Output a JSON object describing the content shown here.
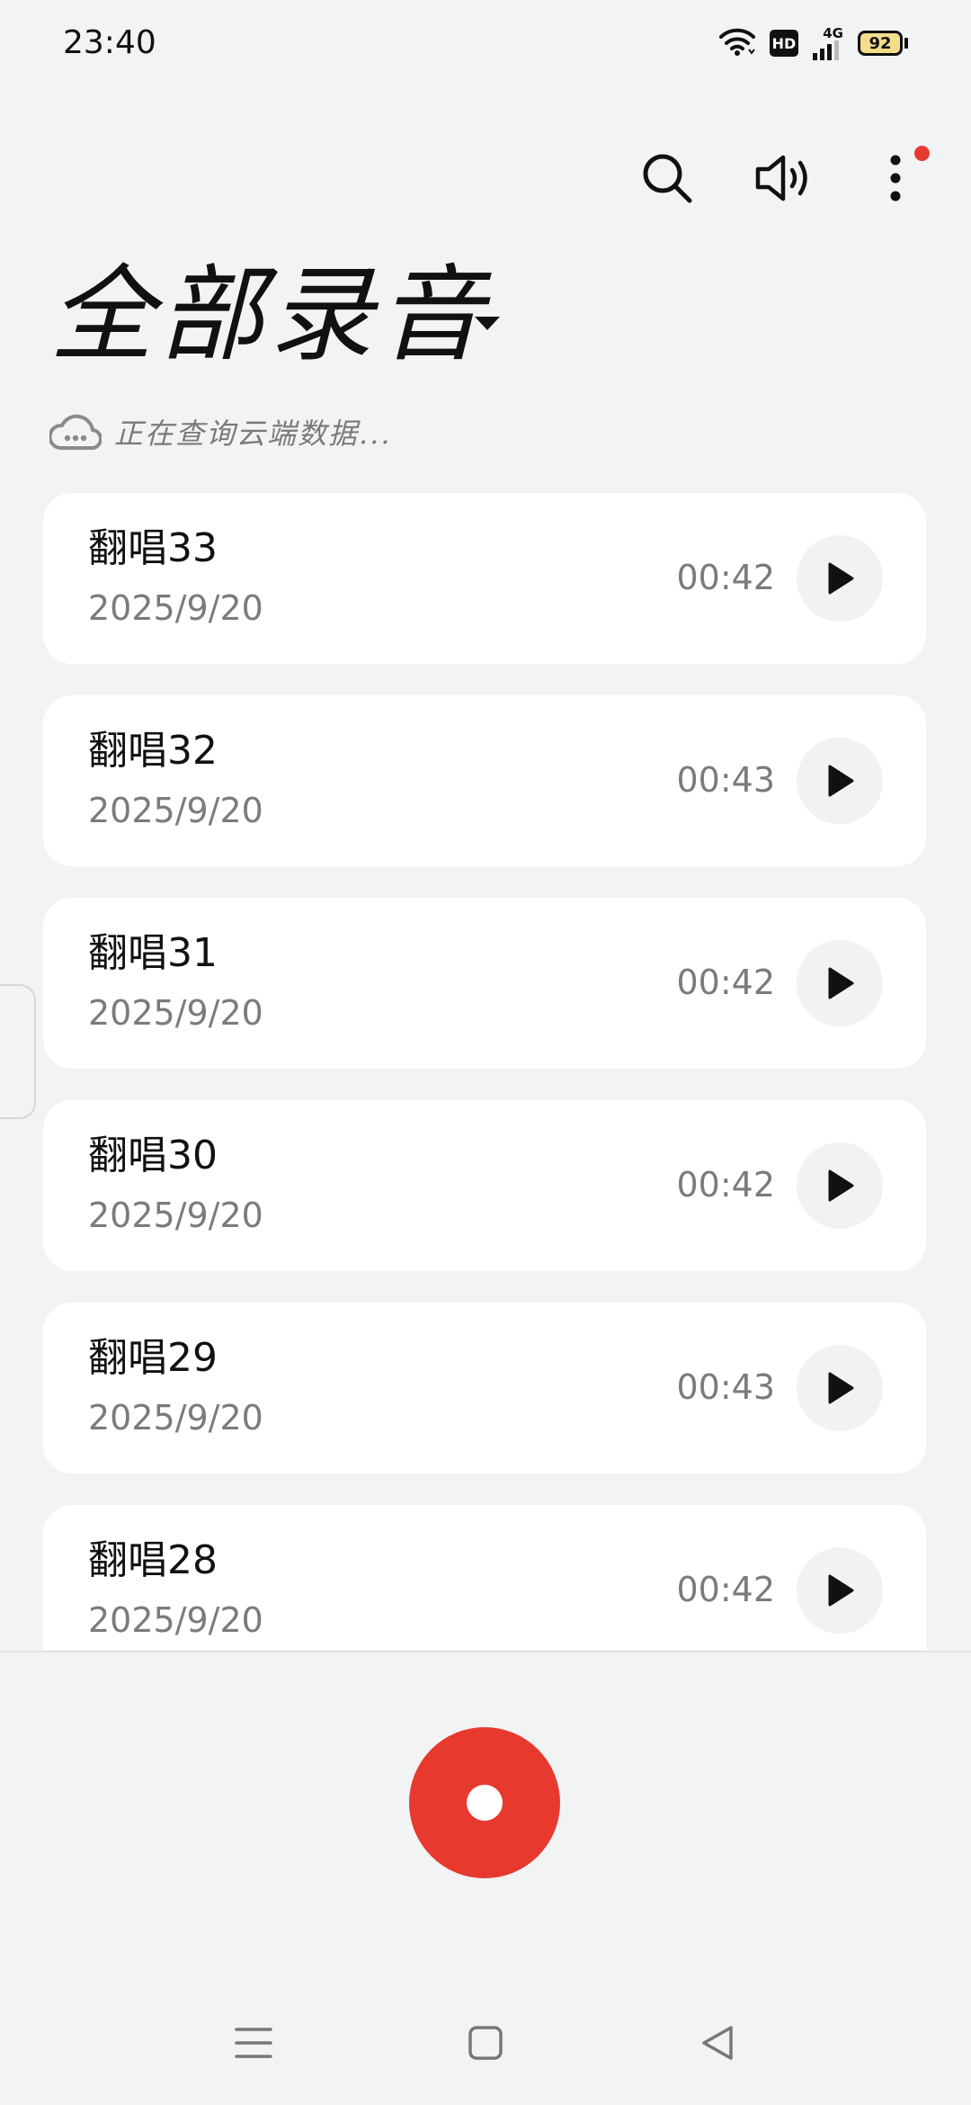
{
  "status_bar": {
    "time": "23:40",
    "hd": "HD",
    "network": "4G",
    "battery": "92",
    "icons": [
      "wifi-icon",
      "hd-icon",
      "signal-icon",
      "battery-icon"
    ]
  },
  "toolbar": {
    "icons": [
      "search-icon",
      "speaker-icon",
      "more-icon"
    ],
    "notification_dot_color": "#e8392f"
  },
  "header": {
    "title": "全部录音",
    "sync_status": "正在查询云端数据..."
  },
  "recordings": [
    {
      "name": "翻唱33",
      "date": "2025/9/20",
      "duration": "00:42"
    },
    {
      "name": "翻唱32",
      "date": "2025/9/20",
      "duration": "00:43"
    },
    {
      "name": "翻唱31",
      "date": "2025/9/20",
      "duration": "00:42"
    },
    {
      "name": "翻唱30",
      "date": "2025/9/20",
      "duration": "00:42"
    },
    {
      "name": "翻唱29",
      "date": "2025/9/20",
      "duration": "00:43"
    },
    {
      "name": "翻唱28",
      "date": "2025/9/20",
      "duration": "00:42"
    }
  ],
  "colors": {
    "background": "#f2f3f5",
    "card": "#ffffff",
    "accent_red": "#e8392f",
    "secondary_text": "#7b7b7b"
  },
  "nav_bar": {
    "icons": [
      "menu-icon",
      "home-icon",
      "back-icon"
    ]
  }
}
